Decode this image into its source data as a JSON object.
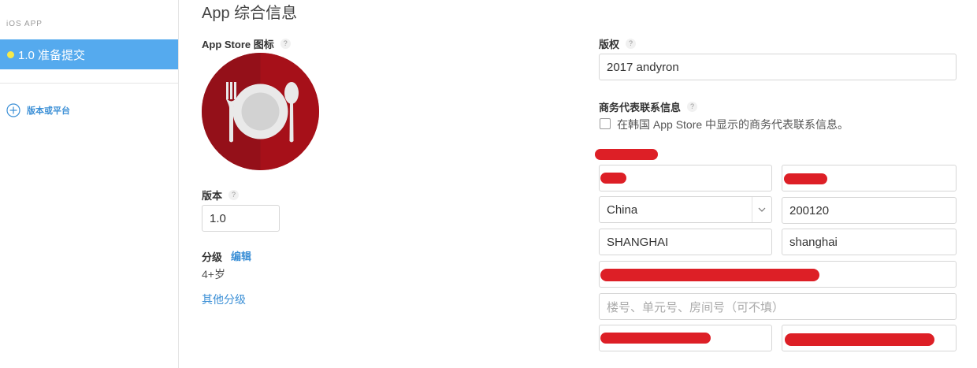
{
  "sidebar": {
    "header": "iOS APP",
    "version_item": "1.0 准备提交",
    "add_label": "版本或平台"
  },
  "page": {
    "title": "App 综合信息"
  },
  "left": {
    "icon_label": "App Store 图标",
    "version_label": "版本",
    "version_value": "1.0",
    "rating_label": "分级",
    "rating_edit": "编辑",
    "rating_value": "4+岁",
    "other_ratings": "其他分级"
  },
  "right": {
    "copyright_label": "版权",
    "copyright_value": "2017 andyron",
    "contact_label": "商务代表联系信息",
    "korea_checkbox_label": "在韩国 App Store 中显示的商务代表联系信息。",
    "country_value": "China",
    "postcode_value": "200120",
    "province_value": "SHANGHAI",
    "city_value": "shanghai",
    "address2_placeholder": "楼号、单元号、房间号（可不填）"
  },
  "help_mark": "?",
  "colors": {
    "accent": "#55aaee",
    "link": "#3b8fd6",
    "icon_red": "#a8161f",
    "redaction": "#dd1f26"
  },
  "icons": [
    "add-circle-icon",
    "help-icon",
    "chevron-down-icon",
    "fork-plate-spoon-icon"
  ]
}
